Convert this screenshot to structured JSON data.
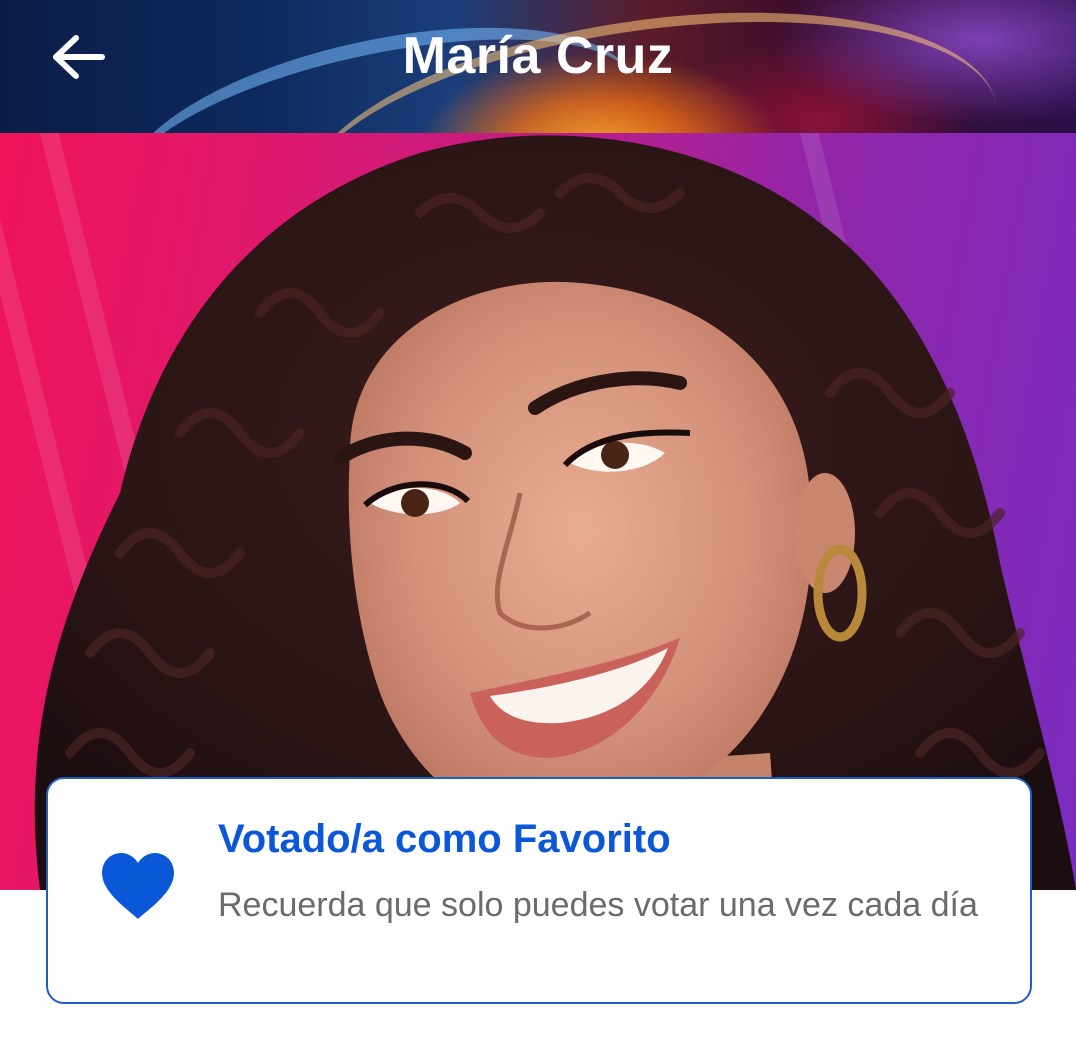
{
  "header": {
    "title": "María Cruz",
    "back_icon": "arrow-left-icon"
  },
  "hero": {
    "image": "contestant-portrait"
  },
  "vote_card": {
    "icon": "heart-icon",
    "title": "Votado/a como Favorito",
    "message": "Recuerda que solo puedes votar una vez cada día",
    "accent_color": "#0a57d8"
  }
}
